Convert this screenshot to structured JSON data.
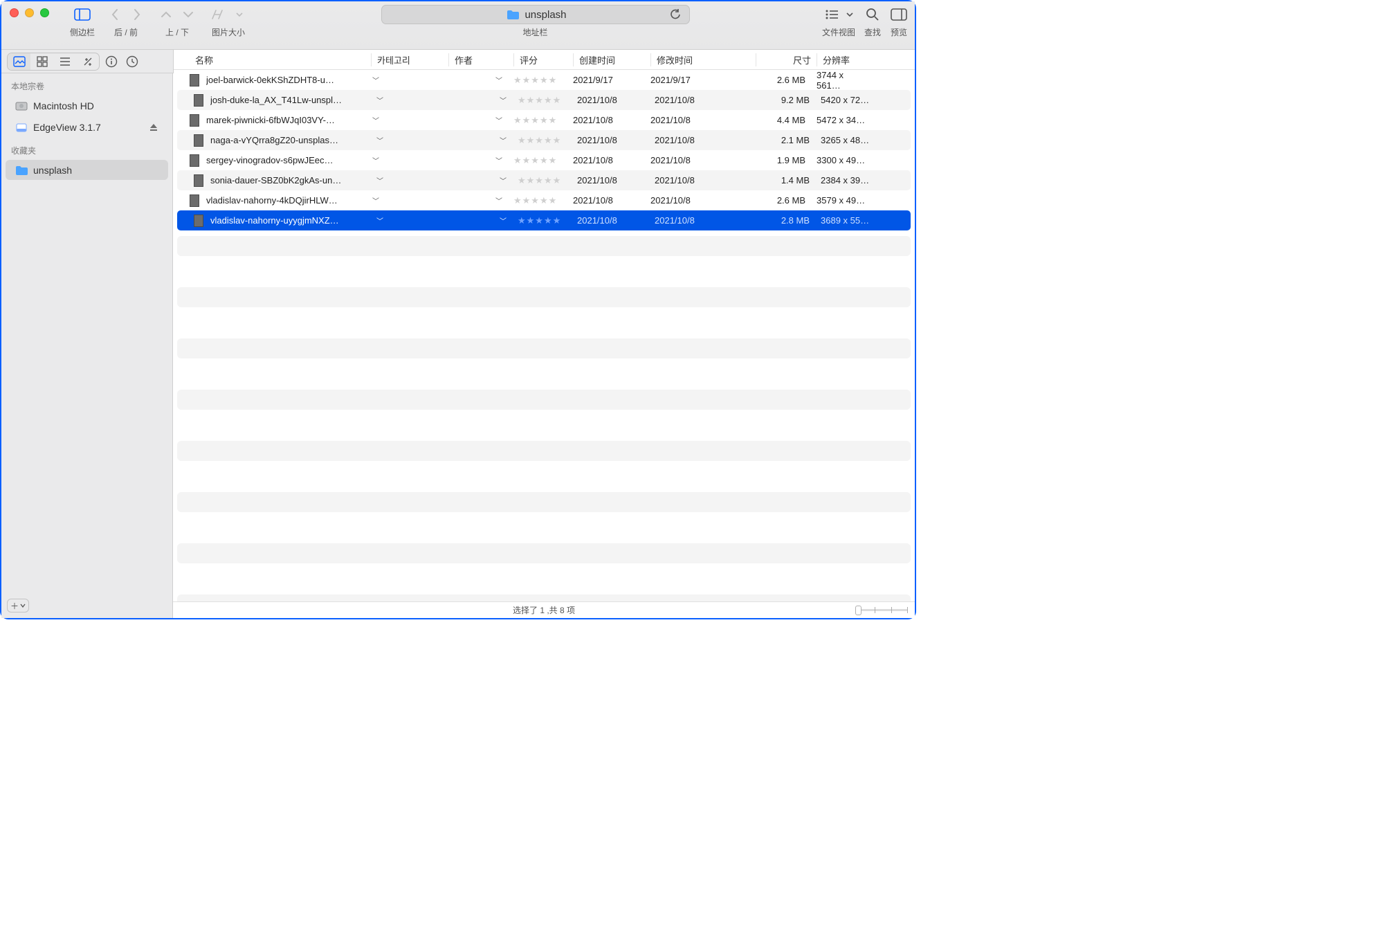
{
  "toolbar": {
    "sidebar_label": "侧边栏",
    "nav_label": "后 / 前",
    "updown_label": "上 / 下",
    "imgsize_label": "图片大小",
    "addr_label": "地址栏",
    "folder_name": "unsplash",
    "fileview_label": "文件视图",
    "search_label": "查找",
    "preview_label": "预览"
  },
  "sidebar": {
    "section_volumes": "本地宗卷",
    "section_favs": "收藏夹",
    "items_volumes": [
      {
        "label": "Macintosh HD",
        "icon": "hdd"
      },
      {
        "label": "EdgeView 3.1.7",
        "icon": "disk",
        "eject": true
      }
    ],
    "items_favs": [
      {
        "label": "unsplash",
        "icon": "folder",
        "selected": true
      }
    ]
  },
  "columns": {
    "name": "名称",
    "category": "카테고리",
    "author": "作者",
    "rating": "评分",
    "created": "创建时间",
    "modified": "修改时间",
    "size": "尺寸",
    "resolution": "分辨率"
  },
  "files": [
    {
      "name": "joel-barwick-0ekKShZDHT8-u…",
      "created": "2021/9/17",
      "modified": "2021/9/17",
      "size": "2.6 MB",
      "res": "3744 x 561…"
    },
    {
      "name": "josh-duke-la_AX_T41Lw-unspl…",
      "created": "2021/10/8",
      "modified": "2021/10/8",
      "size": "9.2 MB",
      "res": "5420 x 72…"
    },
    {
      "name": "marek-piwnicki-6fbWJqI03VY-…",
      "created": "2021/10/8",
      "modified": "2021/10/8",
      "size": "4.4 MB",
      "res": "5472 x 34…"
    },
    {
      "name": "naga-a-vYQrra8gZ20-unsplas…",
      "created": "2021/10/8",
      "modified": "2021/10/8",
      "size": "2.1 MB",
      "res": "3265 x 48…"
    },
    {
      "name": "sergey-vinogradov-s6pwJEec…",
      "created": "2021/10/8",
      "modified": "2021/10/8",
      "size": "1.9 MB",
      "res": "3300 x 49…"
    },
    {
      "name": "sonia-dauer-SBZ0bK2gkAs-un…",
      "created": "2021/10/8",
      "modified": "2021/10/8",
      "size": "1.4 MB",
      "res": "2384 x 39…"
    },
    {
      "name": "vladislav-nahorny-4kDQjirHLW…",
      "created": "2021/10/8",
      "modified": "2021/10/8",
      "size": "2.6 MB",
      "res": "3579 x 49…"
    },
    {
      "name": "vladislav-nahorny-uyygjmNXZ…",
      "created": "2021/10/8",
      "modified": "2021/10/8",
      "size": "2.8 MB",
      "res": "3689 x 55…",
      "selected": true
    }
  ],
  "status": "选择了 1 ,共 8 项"
}
